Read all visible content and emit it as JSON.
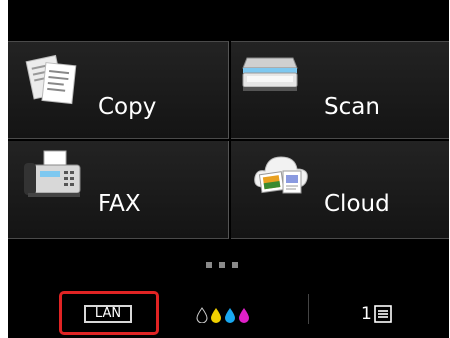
{
  "menu": {
    "tiles": [
      {
        "label": "Copy",
        "icon": "copy-documents-icon"
      },
      {
        "label": "Scan",
        "icon": "scanner-icon"
      },
      {
        "label": "FAX",
        "icon": "fax-machine-icon"
      },
      {
        "label": "Cloud",
        "icon": "cloud-icon"
      }
    ],
    "page_indicator": {
      "pages": 3,
      "current_page": 1
    }
  },
  "status_bar": {
    "lan_label": "LAN",
    "ink": {
      "icon": "ink-level-icon",
      "colors": [
        "#000000",
        "#f0d000",
        "#19a8f0",
        "#e020c8"
      ]
    },
    "jobs_count": "1",
    "jobs_icon": "job-list-icon",
    "highlight_color": "#e02424"
  }
}
